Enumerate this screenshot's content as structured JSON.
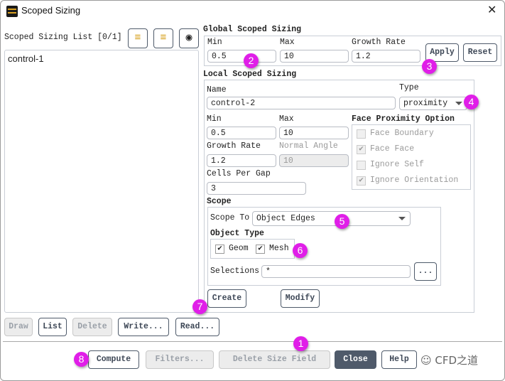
{
  "window": {
    "title": "Scoped Sizing"
  },
  "list": {
    "label": "Scoped Sizing List [0/1]",
    "items": [
      "control-1"
    ]
  },
  "global": {
    "title": "Global Scoped Sizing",
    "min_label": "Min",
    "min": "0.5",
    "max_label": "Max",
    "max": "10",
    "growth_label": "Growth Rate",
    "growth": "1.2",
    "apply": "Apply",
    "reset": "Reset"
  },
  "local": {
    "title": "Local Scoped Sizing",
    "name_label": "Name",
    "name": "control-2",
    "type_label": "Type",
    "type": "proximity",
    "min_label": "Min",
    "min": "0.5",
    "max_label": "Max",
    "max": "10",
    "growth_label": "Growth Rate",
    "growth": "1.2",
    "normal_label": "Normal Angle",
    "normal": "10",
    "cells_label": "Cells Per Gap",
    "cells": "3",
    "fpo": {
      "title": "Face Proximity Option",
      "options": [
        {
          "label": "Face Boundary",
          "checked": false
        },
        {
          "label": "Face Face",
          "checked": true
        },
        {
          "label": "Ignore Self",
          "checked": false
        },
        {
          "label": "Ignore Orientation",
          "checked": true
        }
      ]
    },
    "scope": {
      "title": "Scope",
      "scope_to_label": "Scope To",
      "scope_to": "Object Edges",
      "object_type_label": "Object Type",
      "geom": "Geom",
      "mesh": "Mesh",
      "selections_label": "Selections",
      "selections": "*",
      "browse": "..."
    },
    "create": "Create",
    "modify": "Modify"
  },
  "list_buttons": {
    "draw": "Draw",
    "list": "List",
    "delete": "Delete",
    "write": "Write...",
    "read": "Read..."
  },
  "footer": {
    "compute": "Compute",
    "filters": "Filters...",
    "delete_size_field": "Delete Size Field",
    "close": "Close",
    "help": "Help"
  },
  "watermark": "CFD之道",
  "badges": [
    "1",
    "2",
    "3",
    "4",
    "5",
    "6",
    "7",
    "8"
  ],
  "colors": {
    "badge": "#e01ee8",
    "primary_button": "#4f5a6a"
  }
}
